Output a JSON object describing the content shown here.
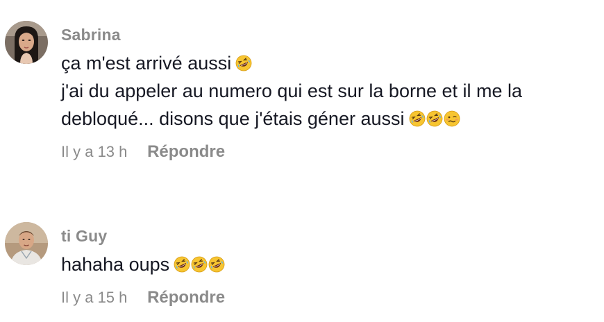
{
  "comments": [
    {
      "username": "Sabrina",
      "lines": [
        "ça m'est arrivé aussi",
        "j'ai du appeler au numero qui est sur la borne et il me la",
        "debloqué... disons que j'étais géner aussi"
      ],
      "line1_emojis": [
        "rofl-emoji"
      ],
      "line3_emojis": [
        "rofl-emoji",
        "rofl-emoji",
        "woozy-face-emoji"
      ],
      "time": "Il y a 13 h",
      "reply_label": "Répondre"
    },
    {
      "username": "ti Guy",
      "lines": [
        "hahaha oups"
      ],
      "line1_emojis": [
        "rofl-emoji",
        "rofl-emoji",
        "rofl-emoji"
      ],
      "time": "Il y a 15 h",
      "reply_label": "Répondre"
    }
  ],
  "colors": {
    "username": "#8a8a8a",
    "text": "#161823",
    "meta": "#8a8a8a",
    "emoji_yellow": "#f7c531"
  }
}
